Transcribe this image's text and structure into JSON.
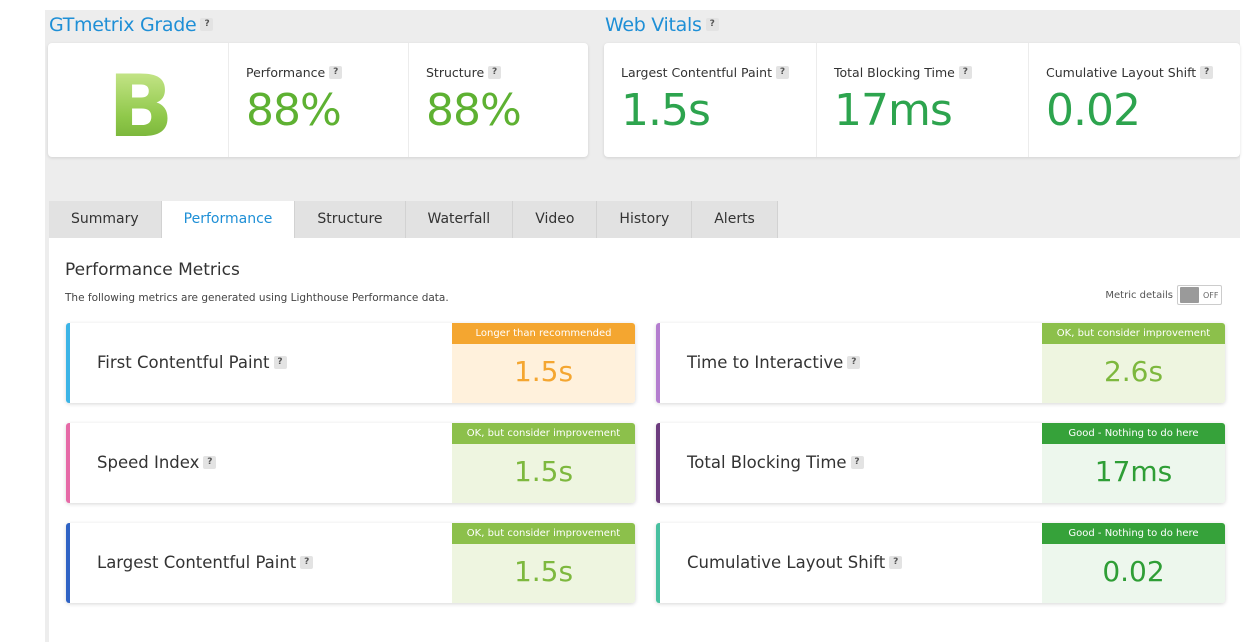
{
  "gtmetrix": {
    "title": "GTmetrix Grade",
    "help": "?",
    "grade": "B",
    "performance": {
      "label": "Performance",
      "help": "?",
      "value": "88%"
    },
    "structure": {
      "label": "Structure",
      "help": "?",
      "value": "88%"
    }
  },
  "web_vitals": {
    "title": "Web Vitals",
    "help": "?",
    "items": [
      {
        "label": "Largest Contentful Paint",
        "help": "?",
        "value": "1.5s"
      },
      {
        "label": "Total Blocking Time",
        "help": "?",
        "value": "17ms"
      },
      {
        "label": "Cumulative Layout Shift",
        "help": "?",
        "value": "0.02"
      }
    ]
  },
  "tabs": [
    "Summary",
    "Performance",
    "Structure",
    "Waterfall",
    "Video",
    "History",
    "Alerts"
  ],
  "active_tab": "Performance",
  "panel": {
    "title": "Performance Metrics",
    "subtitle": "The following metrics are generated using Lighthouse Performance data.",
    "metric_details_label": "Metric details",
    "toggle_state": "OFF"
  },
  "metrics": [
    {
      "name": "First Contentful Paint",
      "help": "?",
      "status": "Longer than recommended",
      "value": "1.5s",
      "bar_color": "#3cb4e6",
      "badge_color": "#f4a630",
      "box_color": "#fff1dc",
      "value_color": "#f4a630"
    },
    {
      "name": "Time to Interactive",
      "help": "?",
      "status": "OK, but consider improvement",
      "value": "2.6s",
      "bar_color": "#b47ecf",
      "badge_color": "#8cc04b",
      "box_color": "#eef5e0",
      "value_color": "#7db83e"
    },
    {
      "name": "Speed Index",
      "help": "?",
      "status": "OK, but consider improvement",
      "value": "1.5s",
      "bar_color": "#e66aa7",
      "badge_color": "#8cc04b",
      "box_color": "#eef5e0",
      "value_color": "#7db83e"
    },
    {
      "name": "Total Blocking Time",
      "help": "?",
      "status": "Good - Nothing to do here",
      "value": "17ms",
      "bar_color": "#6c3c7e",
      "badge_color": "#36a23a",
      "box_color": "#edf7ed",
      "value_color": "#2f9e36"
    },
    {
      "name": "Largest Contentful Paint",
      "help": "?",
      "status": "OK, but consider improvement",
      "value": "1.5s",
      "bar_color": "#2f63c4",
      "badge_color": "#8cc04b",
      "box_color": "#eef5e0",
      "value_color": "#7db83e"
    },
    {
      "name": "Cumulative Layout Shift",
      "help": "?",
      "status": "Good - Nothing to do here",
      "value": "0.02",
      "bar_color": "#48c0a0",
      "badge_color": "#36a23a",
      "box_color": "#edf7ed",
      "value_color": "#2f9e36"
    }
  ]
}
